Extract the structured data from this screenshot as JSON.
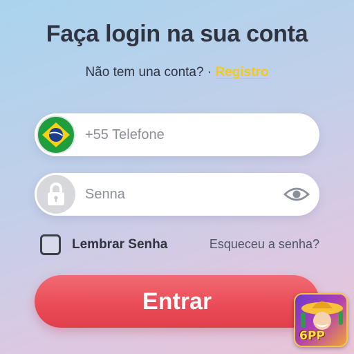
{
  "header": {
    "title": "Faça login na sua conta",
    "subtitle_prefix": "Não tem una conta? · ",
    "register_link": "Registro"
  },
  "form": {
    "phone": {
      "placeholder": "+55 Telefone",
      "flag_icon": "brazil-flag-icon"
    },
    "password": {
      "placeholder": "Senna",
      "lock_icon": "lock-icon",
      "eye_icon": "eye-icon"
    },
    "remember_label": "Lembrar Senha",
    "forgot_link": "Esqueceu a senha?",
    "submit_label": "Entrar"
  },
  "badge": {
    "text": "6PP",
    "logo_icon": "mascot-logo-icon"
  },
  "colors": {
    "accent_red": "#e84a56",
    "link_yellow": "#f3c81f",
    "text_dark": "#2f3440"
  }
}
